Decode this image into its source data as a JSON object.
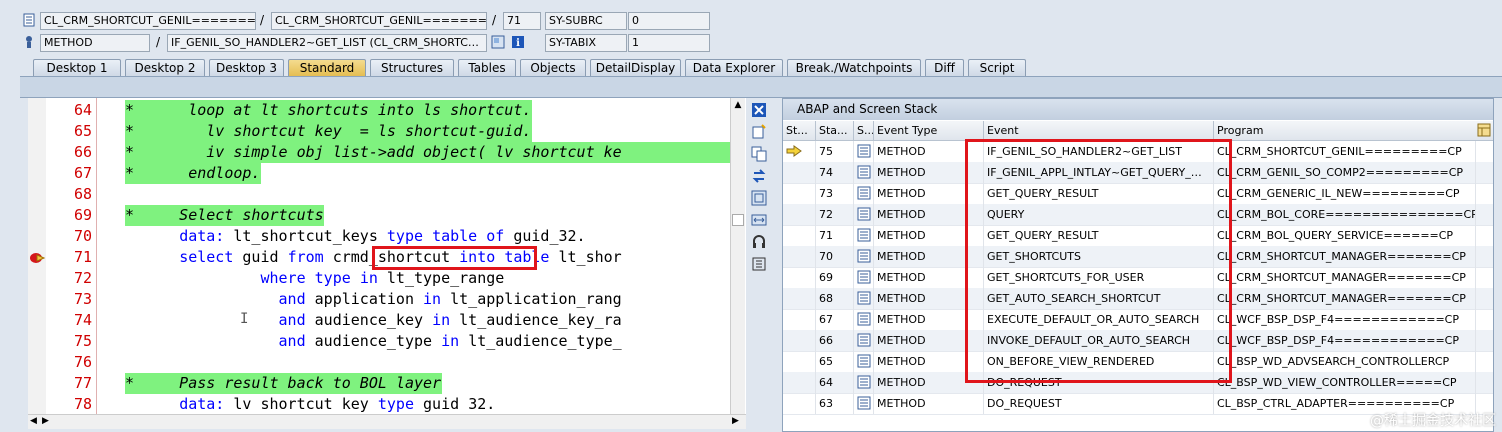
{
  "top": {
    "program_field": "CL_CRM_SHORTCUT_GENIL========…",
    "include_field": "CL_CRM_SHORTCUT_GENIL========…",
    "line_field": "71",
    "sy_subrc_label": "SY-SUBRC",
    "sy_subrc_value": "0",
    "event_type_field": "METHOD",
    "event_field": "IF_GENIL_SO_HANDLER2~GET_LIST (CL_CRM_SHORTC…",
    "sy_tabix_label": "SY-TABIX",
    "sy_tabix_value": "1",
    "sep": "/"
  },
  "tabs": [
    "Desktop 1",
    "Desktop 2",
    "Desktop 3",
    "Standard",
    "Structures",
    "Tables",
    "Objects",
    "DetailDisplay",
    "Data Explorer",
    "Break./Watchpoints",
    "Diff",
    "Script"
  ],
  "active_tab": "Standard",
  "code": {
    "line_numbers": [
      "64",
      "65",
      "66",
      "67",
      "68",
      "69",
      "70",
      "71",
      "72",
      "73",
      "74",
      "75",
      "76",
      "77",
      "78"
    ],
    "lines": [
      {
        "text": "*      loop at lt shortcuts into ls shortcut.",
        "comment": true
      },
      {
        "text": "*        lv shortcut key  = ls shortcut-guid.",
        "comment": true
      },
      {
        "text": "*        iv simple obj list->add object( lv shortcut ke",
        "comment": true
      },
      {
        "text": "*      endloop.",
        "comment": true
      },
      {
        "text": "",
        "comment": false
      },
      {
        "text": "*     Select shortcuts",
        "comment": true
      },
      {
        "text": "      data: lt_shortcut_keys type table of guid_32.",
        "comment": false
      },
      {
        "text": "      select guid from crmd_shortcut into table lt_shor",
        "comment": false
      },
      {
        "text": "               where type in lt_type_range",
        "comment": false
      },
      {
        "text": "                 and application in lt_application_rang",
        "comment": false
      },
      {
        "text": "                 and audience_key in lt_audience_key_ra",
        "comment": false
      },
      {
        "text": "                 and audience_type in lt_audience_type_",
        "comment": false
      },
      {
        "text": "",
        "comment": false
      },
      {
        "text": "*     Pass result back to BOL layer",
        "comment": true
      },
      {
        "text": "      data: lv shortcut key type guid 32.",
        "comment": false
      }
    ]
  },
  "stack": {
    "title": "ABAP and Screen Stack",
    "headers": [
      "St...",
      "Sta...",
      "S...",
      "Event Type",
      "Event",
      "Program"
    ],
    "rows": [
      {
        "level": "75",
        "type": "METHOD",
        "event": "IF_GENIL_SO_HANDLER2~GET_LIST",
        "program": "CL_CRM_SHORTCUT_GENIL=========CP",
        "current": true
      },
      {
        "level": "74",
        "type": "METHOD",
        "event": "IF_GENIL_APPL_INTLAY~GET_QUERY_…",
        "program": "CL_CRM_GENIL_SO_COMP2=========CP"
      },
      {
        "level": "73",
        "type": "METHOD",
        "event": "GET_QUERY_RESULT",
        "program": "CL_CRM_GENERIC_IL_NEW=========CP"
      },
      {
        "level": "72",
        "type": "METHOD",
        "event": "QUERY",
        "program": "CL_CRM_BOL_CORE===============CP"
      },
      {
        "level": "71",
        "type": "METHOD",
        "event": "GET_QUERY_RESULT",
        "program": "CL_CRM_BOL_QUERY_SERVICE======CP"
      },
      {
        "level": "70",
        "type": "METHOD",
        "event": "GET_SHORTCUTS",
        "program": "CL_CRM_SHORTCUT_MANAGER=======CP"
      },
      {
        "level": "69",
        "type": "METHOD",
        "event": "GET_SHORTCUTS_FOR_USER",
        "program": "CL_CRM_SHORTCUT_MANAGER=======CP"
      },
      {
        "level": "68",
        "type": "METHOD",
        "event": "GET_AUTO_SEARCH_SHORTCUT",
        "program": "CL_CRM_SHORTCUT_MANAGER=======CP"
      },
      {
        "level": "67",
        "type": "METHOD",
        "event": "EXECUTE_DEFAULT_OR_AUTO_SEARCH",
        "program": "CL_WCF_BSP_DSP_F4============CP"
      },
      {
        "level": "66",
        "type": "METHOD",
        "event": "INVOKE_DEFAULT_OR_AUTO_SEARCH",
        "program": "CL_WCF_BSP_DSP_F4============CP"
      },
      {
        "level": "65",
        "type": "METHOD",
        "event": "ON_BEFORE_VIEW_RENDERED",
        "program": "CL_BSP_WD_ADVSEARCH_CONTROLLERCP"
      },
      {
        "level": "64",
        "type": "METHOD",
        "event": "DO_REQUEST",
        "program": "CL_BSP_WD_VIEW_CONTROLLER=====CP"
      },
      {
        "level": "63",
        "type": "METHOD",
        "event": "DO_REQUEST",
        "program": "CL_BSP_CTRL_ADAPTER==========CP"
      }
    ]
  },
  "watermark": "@稀土掘金技术社区",
  "colors": {
    "comment_bg": "#7ff27f",
    "keyword": "#0000ff",
    "line_number": "#d00000",
    "highlight": "#e0151b",
    "active_tab": "#e5bd52"
  }
}
